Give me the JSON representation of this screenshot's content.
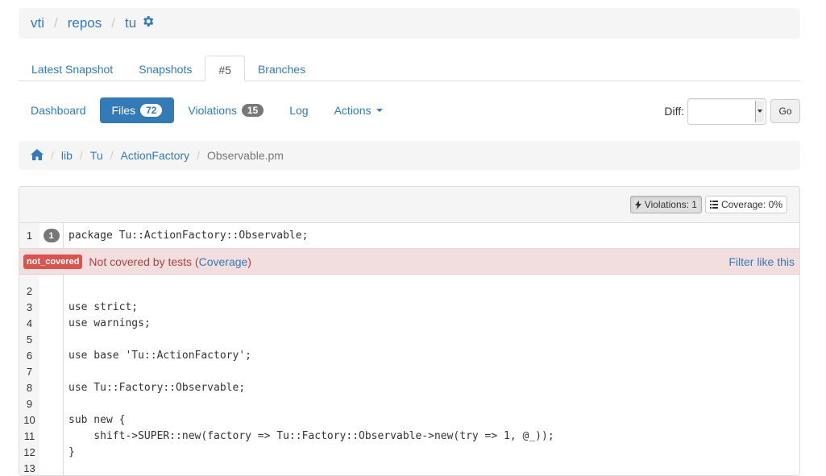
{
  "topcrumb": {
    "items": [
      "vti",
      "repos",
      "tu"
    ],
    "settings_icon": "gear-icon"
  },
  "tabs": [
    {
      "label": "Latest Snapshot",
      "active": false
    },
    {
      "label": "Snapshots",
      "active": false
    },
    {
      "label": "#5",
      "active": true
    },
    {
      "label": "Branches",
      "active": false
    }
  ],
  "pills": {
    "dashboard": "Dashboard",
    "files": "Files",
    "files_count": "72",
    "violations": "Violations",
    "violations_count": "15",
    "log": "Log",
    "actions": "Actions"
  },
  "diff": {
    "label": "Diff:",
    "value": "",
    "go": "Go"
  },
  "filecrumb": {
    "home_icon": "home-icon",
    "items": [
      "lib",
      "Tu",
      "ActionFactory"
    ],
    "current": "Observable.pm"
  },
  "panel": {
    "violations_btn": "Violations: 1",
    "coverage_btn": "Coverage: 0%"
  },
  "code": {
    "first": {
      "num": "1",
      "badge": "1",
      "text": "package Tu::ActionFactory::Observable;"
    },
    "violation": {
      "tag": "not_covered",
      "message": "Not covered by tests (",
      "link": "Coverage",
      "close": ")",
      "filter": "Filter like this"
    },
    "lines": [
      {
        "num": "2",
        "text": ""
      },
      {
        "num": "3",
        "text": "use strict;"
      },
      {
        "num": "4",
        "text": "use warnings;"
      },
      {
        "num": "5",
        "text": ""
      },
      {
        "num": "6",
        "text": "use base 'Tu::ActionFactory';"
      },
      {
        "num": "7",
        "text": ""
      },
      {
        "num": "8",
        "text": "use Tu::Factory::Observable;"
      },
      {
        "num": "9",
        "text": ""
      },
      {
        "num": "10",
        "text": "sub new {"
      },
      {
        "num": "11",
        "text": "    shift->SUPER::new(factory => Tu::Factory::Observable->new(try => 1, @_));"
      },
      {
        "num": "12",
        "text": "}"
      },
      {
        "num": "13",
        "text": ""
      }
    ]
  },
  "colors": {
    "primary": "#337ab7",
    "danger": "#d9534f",
    "danger_bg": "#f2dede"
  }
}
